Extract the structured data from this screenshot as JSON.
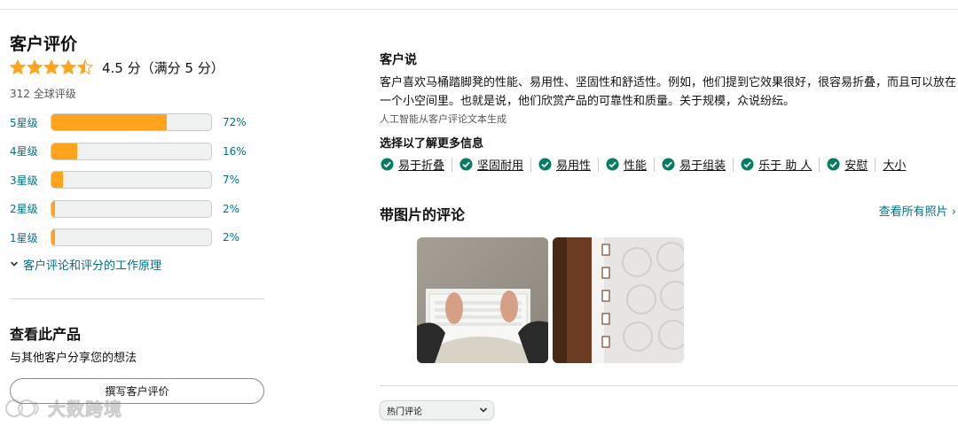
{
  "left": {
    "title": "客户评价",
    "average_text": "4.5 分（满分 5 分）",
    "average_rating": 4.5,
    "max_rating": 5,
    "total_ratings": "312 全球评级",
    "histogram": [
      {
        "label": "5星级",
        "percent_text": "72%",
        "percent": 72
      },
      {
        "label": "4星级",
        "percent_text": "16%",
        "percent": 16
      },
      {
        "label": "3星级",
        "percent_text": "7%",
        "percent": 7
      },
      {
        "label": "2星级",
        "percent_text": "2%",
        "percent": 2
      },
      {
        "label": "1星级",
        "percent_text": "2%",
        "percent": 2
      }
    ],
    "how_it_works": "客户评论和评分的工作原理",
    "review_heading": "查看此产品",
    "review_sub": "与其他客户分享您的想法",
    "write_button": "撰写客户评价"
  },
  "watermark": {
    "text": "大数跨境"
  },
  "right": {
    "customers_say_title": "客户说",
    "customers_say_text": "客户喜欢马桶踏脚凳的性能、易用性、坚固性和舒适性。例如，他们提到它效果很好，很容易折叠，而且可以放在一个小空间里。也就是说，他们欣赏产品的可靠性和质量。关于规模，众说纷纭。",
    "ai_note": "人工智能从客户评论文本生成",
    "learn_more": "选择以了解更多信息",
    "chips": [
      {
        "label": "易于折叠",
        "checked": true
      },
      {
        "label": "坚固耐用",
        "checked": true
      },
      {
        "label": "易用性",
        "checked": true
      },
      {
        "label": "性能",
        "checked": true
      },
      {
        "label": "易于组装",
        "checked": true
      },
      {
        "label": "乐于 助 人",
        "checked": true
      },
      {
        "label": "安慰",
        "checked": true
      },
      {
        "label": "大小",
        "checked": false
      }
    ],
    "photos_title": "带图片的评论",
    "see_all_photos": "查看所有照片 ›",
    "sort_select": "热门评论"
  },
  "colors": {
    "star": "#ffa41c",
    "bar_fill": "#ffa41c",
    "link": "#007185",
    "check": "#067d62"
  }
}
